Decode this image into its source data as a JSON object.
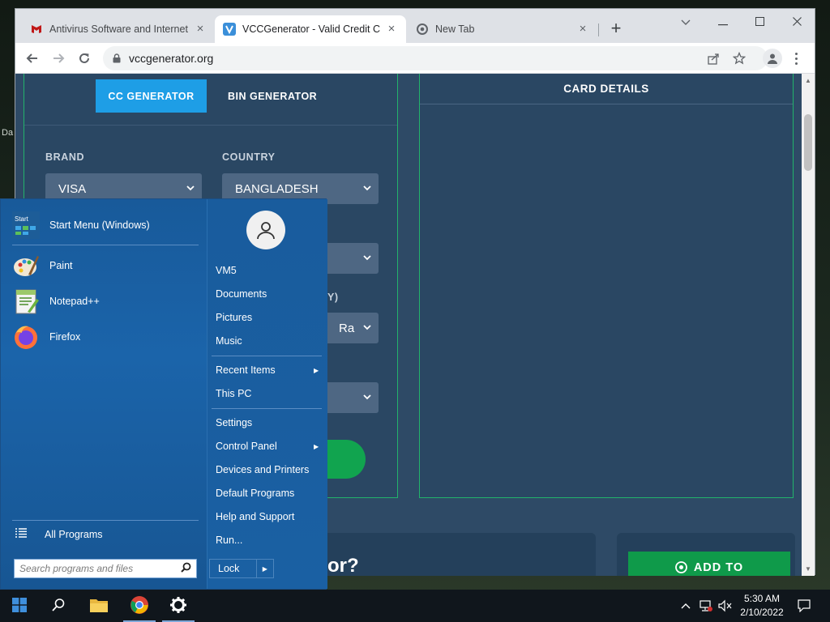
{
  "desktop": {
    "fragment": "Da"
  },
  "browser": {
    "tabs": [
      {
        "title": "Antivirus Software and Internet S",
        "icon": "mcafee-icon"
      },
      {
        "title": "VCCGenerator - Valid Credit Card",
        "icon": "vcc-icon"
      },
      {
        "title": "New Tab",
        "icon": "chrome-icon"
      }
    ],
    "url": "vccgenerator.org"
  },
  "page": {
    "generator_tabs": {
      "cc": "CC GENERATOR",
      "bin": "BIN GENERATOR"
    },
    "brand": {
      "label": "BRAND",
      "value": "VISA"
    },
    "country": {
      "label": "COUNTRY",
      "value": "BANGLADESH"
    },
    "partial_label": "Y)",
    "partial_select": "Ra",
    "card_details_title": "CARD DETAILS",
    "lower_heading_fragment": "or?",
    "add_to_button": "ADD TO"
  },
  "start_menu": {
    "programs": [
      {
        "label": "Start Menu (Windows)",
        "icon": "start-menu-icon"
      },
      {
        "label": "Paint",
        "icon": "paint-icon"
      },
      {
        "label": "Notepad++",
        "icon": "notepadpp-icon"
      },
      {
        "label": "Firefox",
        "icon": "firefox-icon"
      }
    ],
    "all_programs": "All Programs",
    "search_placeholder": "Search programs and files",
    "right_items": [
      "VM5",
      "Documents",
      "Pictures",
      "Music",
      "Recent Items",
      "This PC",
      "Settings",
      "Control Panel",
      "Devices and Printers",
      "Default Programs",
      "Help and Support",
      "Run..."
    ],
    "lock": "Lock"
  },
  "taskbar": {
    "time": "5:30 AM",
    "date": "2/10/2022"
  },
  "colors": {
    "page_bg": "#2e4a66",
    "accent_blue": "#1e9ee6",
    "accent_green": "#11a44f",
    "startmenu_blue": "#1a5c9e"
  }
}
